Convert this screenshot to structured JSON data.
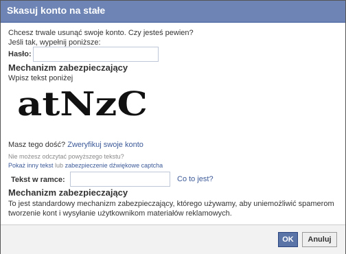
{
  "dialog": {
    "title": "Skasuj konto na stałe",
    "intro_line1": "Chcesz trwale usunąć swoje konto. Czy jesteś pewien?",
    "intro_line2": "Jeśli tak, wypełnij poniższe:",
    "password_label": "Hasło:",
    "password_value": ""
  },
  "security": {
    "heading": "Mechanizm zabezpieczający",
    "instruction": "Wpisz tekst poniżej",
    "captcha_text": "atNzC"
  },
  "verify": {
    "prefix": "Masz tego dość?",
    "link": "Zweryfikuj swoje konto"
  },
  "captcha_help": {
    "question": "Nie możesz odczytać powyższego tekstu?",
    "other_text_link": "Pokaż inny tekst",
    "or": "lub",
    "audio_link": "zabezpieczenie dźwiękowe captcha"
  },
  "answer": {
    "label": "Tekst w ramce:",
    "value": "",
    "what_link": "Co to jest?"
  },
  "explanation": {
    "heading": "Mechanizm zabezpieczający",
    "line1": "To jest standardowy mechanizm zabezpieczający, którego używamy, aby uniemożliwić spamerom",
    "line2": "tworzenie kont i wysyłanie użytkownikom materiałów reklamowych."
  },
  "buttons": {
    "ok": "OK",
    "cancel": "Anuluj"
  },
  "colors": {
    "title_bar": "#6d84b4",
    "link": "#3b5998",
    "ok_button": "#5b74a8"
  }
}
